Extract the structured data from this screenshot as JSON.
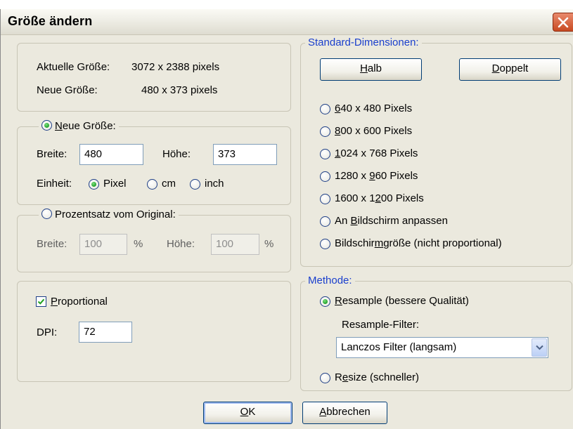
{
  "dialog": {
    "title": "Größe ändern"
  },
  "info": {
    "current_label": "Aktuelle Größe:",
    "current_value": "3072  x  2388  pixels",
    "new_label": "Neue Größe:",
    "new_value": "480  x  373  pixels"
  },
  "new_size": {
    "radio_label_pre": "",
    "radio_label_key": "N",
    "radio_label_rest": "eue Größe:",
    "selected": true,
    "width_label": "Breite:",
    "width_value": "480",
    "height_label": "Höhe:",
    "height_value": "373",
    "unit_label": "Einheit:",
    "units": [
      {
        "label": "Pixel",
        "selected": true
      },
      {
        "label": "cm",
        "selected": false
      },
      {
        "label": "inch",
        "selected": false
      }
    ]
  },
  "percent": {
    "radio_label": "Prozentsatz vom Original:",
    "selected": false,
    "width_label": "Breite:",
    "width_value": "100",
    "height_label": "Höhe:",
    "height_value": "100",
    "unit": "%"
  },
  "options": {
    "proportional_key": "P",
    "proportional_rest": "roportional",
    "proportional_checked": true,
    "dpi_label": "DPI:",
    "dpi_value": "72"
  },
  "standard": {
    "legend": "Standard-Dimensionen:",
    "half_key": "H",
    "half_rest": "alb",
    "double_key": "D",
    "double_rest": "oppelt",
    "sizes": [
      {
        "pre": "",
        "key": "6",
        "rest": "40 x 480 Pixels"
      },
      {
        "pre": "",
        "key": "8",
        "rest": "00 x 600 Pixels"
      },
      {
        "pre": "",
        "key": "1",
        "rest": "024 x 768 Pixels"
      },
      {
        "pre": "1280 x ",
        "key": "9",
        "rest": "60 Pixels"
      },
      {
        "pre": "1600 x 1",
        "key": "2",
        "rest": "00 Pixels"
      },
      {
        "pre": "An ",
        "key": "B",
        "rest": "ildschirm anpassen"
      },
      {
        "pre": "Bildschir",
        "key": "m",
        "rest": "größe (nicht proportional)"
      }
    ]
  },
  "method": {
    "legend": "Methode:",
    "resample_key": "R",
    "resample_rest": "esample (bessere Qualität)",
    "resample_selected": true,
    "filter_label": "Resample-Filter:",
    "filter_value": "Lanczos Filter (langsam)",
    "resize_pre": "R",
    "resize_key": "e",
    "resize_rest": "size (schneller)",
    "resize_selected": false
  },
  "footer": {
    "ok_key": "O",
    "ok_rest": "K",
    "cancel_key": "A",
    "cancel_rest": "bbrechen"
  },
  "colors": {
    "dialog_bg": "#ebe9de",
    "legend_blue": "#1a3fcd",
    "close_red": "#c84a22",
    "radio_green": "#1fa12a"
  }
}
